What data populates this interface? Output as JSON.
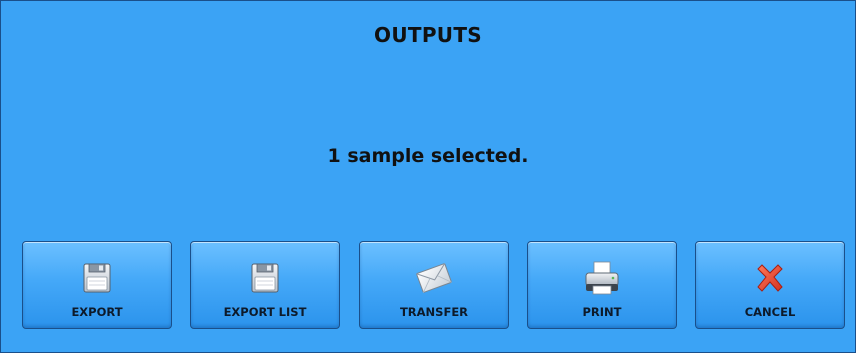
{
  "dialog": {
    "title": "OUTPUTS",
    "message": "1 sample selected."
  },
  "buttons": {
    "export": {
      "label": "EXPORT",
      "icon": "floppy-disk-icon"
    },
    "export_list": {
      "label": "EXPORT LIST",
      "icon": "floppy-disk-icon"
    },
    "transfer": {
      "label": "TRANSFER",
      "icon": "envelope-icon"
    },
    "print": {
      "label": "PRINT",
      "icon": "printer-icon"
    },
    "cancel": {
      "label": "CANCEL",
      "icon": "red-x-icon"
    }
  },
  "colors": {
    "dialog_background": "#3ba3f5",
    "button_top": "#6cc0ff",
    "button_bottom": "#2b93ec",
    "text": "#111111",
    "cancel_x": "#e8402f"
  }
}
